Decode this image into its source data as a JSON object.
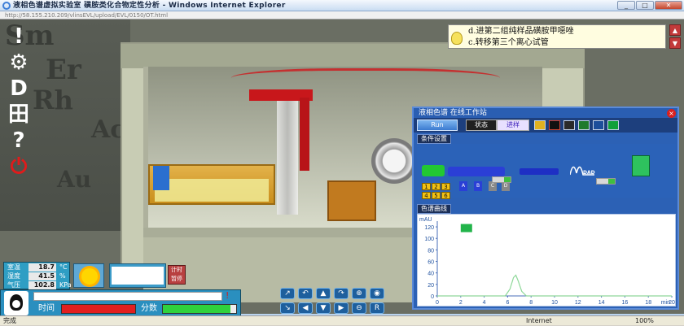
{
  "window": {
    "title": "液相色谱虚拟实验室 磺胺类化合物定性分析 - Windows Internet Explorer",
    "address": "http://58.155.210.209/vlinsEVL/upload/EVL/0150/OT.html"
  },
  "backdrop": {
    "periodic_letters": [
      "Sm",
      "Er",
      "Rh",
      "Ac",
      "Au"
    ]
  },
  "hint": {
    "line1": "d.进第二组纯样品磺胺甲噁唑",
    "line2": "c.转移第三个离心试管"
  },
  "panel": {
    "title": "液相色谱 在线工作站",
    "close": "×",
    "run_label": "Run",
    "state_label": "状态",
    "progress_label": "进样",
    "conditions_label": "条件设置",
    "curve_label": "色谱曲线",
    "dad_label": "DAD",
    "grid_numbers": [
      "1",
      "2",
      "3",
      "4",
      "5",
      "6"
    ],
    "valves": [
      "A",
      "B",
      "C",
      "D"
    ]
  },
  "chart_data": {
    "type": "line",
    "title": "",
    "ylabel": "mAU",
    "xlabel": "min",
    "xlim": [
      0,
      20
    ],
    "ylim": [
      0,
      130
    ],
    "xticks": [
      0,
      2,
      4,
      6,
      8,
      10,
      12,
      14,
      16,
      18,
      20
    ],
    "yticks": [
      0,
      20,
      40,
      60,
      80,
      100,
      120
    ],
    "series": [
      {
        "color": "#8fd89a",
        "x": [
          0,
          5.8,
          6.2,
          6.5,
          6.7,
          6.9,
          7.2,
          7.6,
          20
        ],
        "y": [
          0,
          0,
          12,
          32,
          36,
          26,
          8,
          0,
          0
        ]
      }
    ],
    "marker_color": "#22b44a"
  },
  "environment": {
    "temp_label": "室温",
    "temp_value": "18.7",
    "temp_unit": "°C",
    "humidity_label": "湿度",
    "humidity_value": "41.5",
    "humidity_unit": "%",
    "pressure_label": "气压",
    "pressure_value": "102.8",
    "pressure_unit": "KPa"
  },
  "timer": {
    "label": "计时\n暂停"
  },
  "footer": {
    "time_label": "时间",
    "score_label": "分数",
    "score_fraction": 0.92,
    "warning": "!"
  },
  "camera": {
    "buttons": [
      "↗",
      "↶",
      "▲",
      "↷",
      "⊕",
      "◉",
      "↘",
      "◀",
      "▼",
      "▶",
      "⊖",
      "R"
    ]
  },
  "statusbar": {
    "done": "完成",
    "zone": "Internet",
    "zoom": "100%"
  },
  "left_tools": [
    "!",
    "⚙",
    "Ⅾ",
    "田",
    "?",
    "⏻"
  ]
}
